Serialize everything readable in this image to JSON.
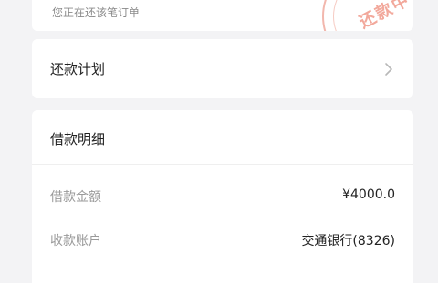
{
  "header": {
    "subtitle": "您正在还该笔订单",
    "stamp_text": "还款中"
  },
  "repayment_plan": {
    "label": "还款计划"
  },
  "loan_details": {
    "title": "借款明细",
    "rows": [
      {
        "label": "借款金额",
        "value": "¥4000.0"
      },
      {
        "label": "收款账户",
        "value": "交通银行(8326)"
      }
    ]
  }
}
